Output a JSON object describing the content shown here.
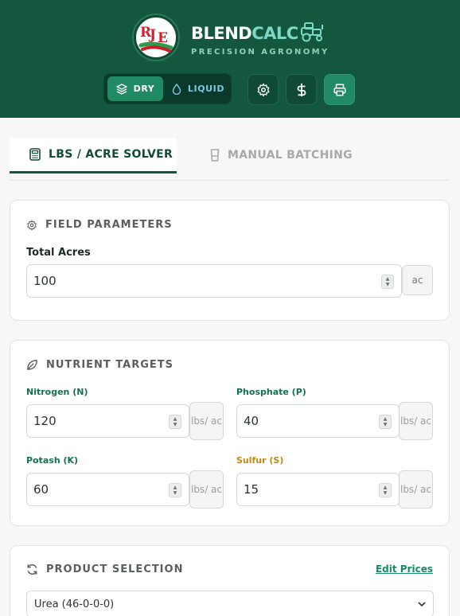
{
  "header": {
    "logo_text": "RJE",
    "brand_part1": "BLEND",
    "brand_part2": "CALC",
    "tagline": "PRECISION AGRONOMY",
    "mode_dry": "DRY",
    "mode_liquid": "LIQUID",
    "icons": [
      "layers-icon",
      "droplet-icon",
      "gear-icon",
      "dollar-icon",
      "printer-icon",
      "tractor-icon"
    ]
  },
  "tabs": [
    {
      "label": "LBS / ACRE SOLVER",
      "active": true,
      "icon": "calculator-icon"
    },
    {
      "label": "MANUAL BATCHING",
      "active": false,
      "icon": "beaker-icon"
    }
  ],
  "field": {
    "title": "FIELD PARAMETERS",
    "acres_label": "Total Acres",
    "acres_value": "100",
    "acres_unit": "ac"
  },
  "nutrients": {
    "title": "NUTRIENT TARGETS",
    "unit": "lbs/ ac",
    "items": [
      {
        "label": "Nitrogen (N)",
        "value": "120"
      },
      {
        "label": "Phosphate (P)",
        "value": "40"
      },
      {
        "label": "Potash (K)",
        "value": "60"
      },
      {
        "label": "Sulfur (S)",
        "value": "15"
      }
    ]
  },
  "products": {
    "title": "PRODUCT SELECTION",
    "edit_link": "Edit Prices",
    "selected": "Urea (46-0-0-0)"
  },
  "colors": {
    "header_bg": "#13573f",
    "accent": "#1f8a64",
    "brand_calc": "#7dd8c4",
    "sulfur_label": "#c28a14"
  }
}
